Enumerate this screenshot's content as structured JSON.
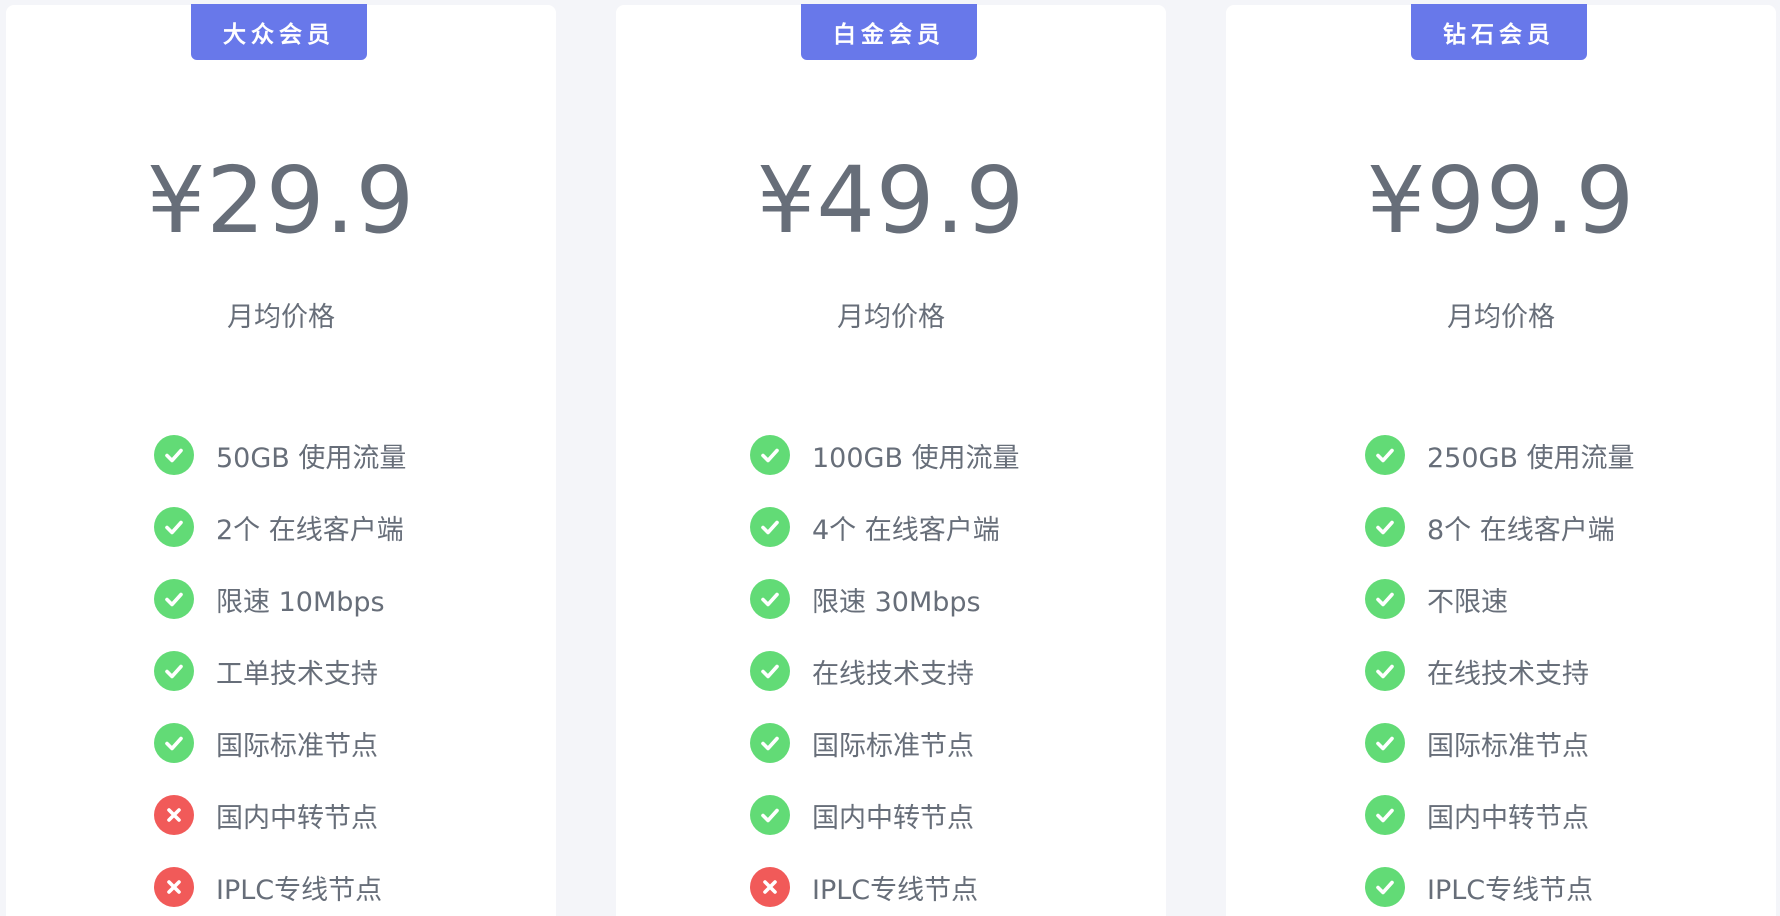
{
  "plans": [
    {
      "name": "大众会员",
      "price": "¥29.9",
      "price_note": "月均价格",
      "features": [
        {
          "label": "50GB 使用流量",
          "included": true,
          "icon": "check-icon"
        },
        {
          "label": "2个 在线客户端",
          "included": true,
          "icon": "check-icon"
        },
        {
          "label": "限速 10Mbps",
          "included": true,
          "icon": "check-icon"
        },
        {
          "label": "工单技术支持",
          "included": true,
          "icon": "check-icon"
        },
        {
          "label": "国际标准节点",
          "included": true,
          "icon": "check-icon"
        },
        {
          "label": "国内中转节点",
          "included": false,
          "icon": "cross-icon"
        },
        {
          "label": "IPLC专线节点",
          "included": false,
          "icon": "cross-icon"
        }
      ]
    },
    {
      "name": "白金会员",
      "price": "¥49.9",
      "price_note": "月均价格",
      "features": [
        {
          "label": "100GB 使用流量",
          "included": true,
          "icon": "check-icon"
        },
        {
          "label": "4个 在线客户端",
          "included": true,
          "icon": "check-icon"
        },
        {
          "label": "限速 30Mbps",
          "included": true,
          "icon": "check-icon"
        },
        {
          "label": "在线技术支持",
          "included": true,
          "icon": "check-icon"
        },
        {
          "label": "国际标准节点",
          "included": true,
          "icon": "check-icon"
        },
        {
          "label": "国内中转节点",
          "included": true,
          "icon": "check-icon"
        },
        {
          "label": "IPLC专线节点",
          "included": false,
          "icon": "cross-icon"
        }
      ]
    },
    {
      "name": "钻石会员",
      "price": "¥99.9",
      "price_note": "月均价格",
      "features": [
        {
          "label": "250GB 使用流量",
          "included": true,
          "icon": "check-icon"
        },
        {
          "label": "8个 在线客户端",
          "included": true,
          "icon": "check-icon"
        },
        {
          "label": "不限速",
          "included": true,
          "icon": "check-icon"
        },
        {
          "label": "在线技术支持",
          "included": true,
          "icon": "check-icon"
        },
        {
          "label": "国际标准节点",
          "included": true,
          "icon": "check-icon"
        },
        {
          "label": "国内中转节点",
          "included": true,
          "icon": "check-icon"
        },
        {
          "label": "IPLC专线节点",
          "included": true,
          "icon": "check-icon"
        }
      ]
    }
  ],
  "colors": {
    "badge": "#6878ea",
    "included": "#62db76",
    "excluded": "#f15a59",
    "text": "#676e79",
    "background": "#f4f5f9",
    "card": "#ffffff"
  }
}
